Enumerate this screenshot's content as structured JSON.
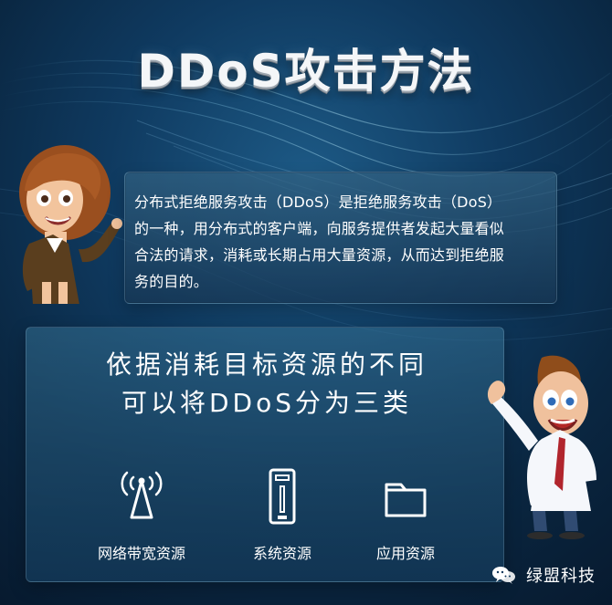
{
  "page": {
    "title": "DDoS攻击方法",
    "intro": "分布式拒绝服务攻击（DDoS）是拒绝服务攻击（DoS）\n的一种，用分布式的客户端，向服务提供者发起大量看似\n合法的请求，消耗或长期占用大量资源，从而达到拒绝服\n务的目的。",
    "section_heading": "依据消耗目标资源的不同\n可以将DDoS分为三类",
    "categories": [
      {
        "label": "网络带宽资源",
        "icon": "antenna-icon"
      },
      {
        "label": "系统资源",
        "icon": "server-icon"
      },
      {
        "label": "应用资源",
        "icon": "folder-icon"
      }
    ],
    "brand": {
      "label": "绿盟科技",
      "icon": "wechat-icon"
    }
  }
}
